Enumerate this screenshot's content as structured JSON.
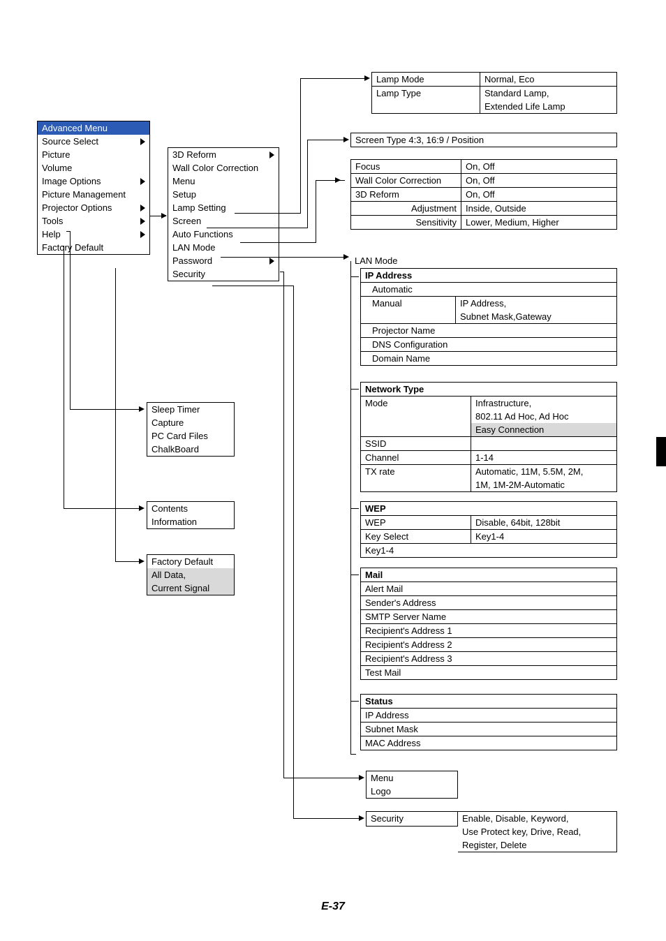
{
  "page_footer": "E-37",
  "main_menu": {
    "title": "Advanced Menu",
    "items": [
      "Source Select",
      "Picture",
      "Volume",
      "Image Options",
      "Picture Management",
      "Projector Options",
      "Tools",
      "Help",
      "Factory Default"
    ]
  },
  "projector_options_sub": [
    "3D Reform",
    "Wall Color Correction",
    "Menu",
    "Setup",
    "Lamp Setting",
    "Screen",
    "Auto Functions",
    "LAN Mode",
    "Password",
    "Security"
  ],
  "tools_sub": [
    "Sleep Timer",
    "Capture",
    "PC Card Files",
    "ChalkBoard"
  ],
  "help_sub": [
    "Contents",
    "Information"
  ],
  "factory_default_sub": [
    "Factory Default",
    "All Data,",
    "Current Signal"
  ],
  "lamp_setting": {
    "rows": [
      {
        "label": "Lamp Mode",
        "value": "Normal, Eco"
      },
      {
        "label": "Lamp Type",
        "value": "Standard Lamp,"
      }
    ],
    "extra_value": "Extended Life Lamp"
  },
  "screen_setting": {
    "text": "Screen Type 4:3, 16:9 / Position"
  },
  "auto_functions": {
    "rows": [
      {
        "label": "Focus",
        "value": "On, Off"
      },
      {
        "label": "Wall Color Correction",
        "value": "On, Off"
      },
      {
        "label": "3D Reform",
        "value": "On, Off"
      },
      {
        "label": "Adjustment",
        "value": "Inside, Outside",
        "align": "right"
      },
      {
        "label": "Sensitivity",
        "value": "Lower, Medium, Higher",
        "align": "right"
      }
    ]
  },
  "lan_mode": {
    "title": "LAN Mode",
    "ip_address": {
      "header": "IP Address",
      "rows": [
        {
          "label": "Automatic",
          "value": ""
        },
        {
          "label": "Manual",
          "value": "IP Address,"
        },
        {
          "label": "",
          "value": "Subnet Mask,Gateway"
        },
        {
          "label": "Projector Name",
          "value": ""
        },
        {
          "label": "DNS Configuration",
          "value": ""
        },
        {
          "label": "Domain Name",
          "value": ""
        }
      ]
    },
    "network_type": {
      "header": "Network Type",
      "rows": [
        {
          "label": "Mode",
          "value": "Infrastructure,"
        },
        {
          "label": "",
          "value": "802.11 Ad Hoc, Ad Hoc"
        },
        {
          "label": "",
          "value": "Easy Connection"
        },
        {
          "label": "SSID",
          "value": ""
        },
        {
          "label": "Channel",
          "value": "1-14"
        },
        {
          "label": "TX rate",
          "value": "Automatic, 11M, 5.5M, 2M,"
        },
        {
          "label": "",
          "value": "1M, 1M-2M-Automatic"
        }
      ]
    },
    "wep": {
      "header": "WEP",
      "rows": [
        {
          "label": "WEP",
          "value": "Disable, 64bit, 128bit"
        },
        {
          "label": "Key Select",
          "value": "Key1-4"
        },
        {
          "label": "Key1-4",
          "value": ""
        }
      ]
    },
    "mail": {
      "header": "Mail",
      "rows": [
        "Alert Mail",
        "Sender's Address",
        "SMTP Server Name",
        "Recipient's Address 1",
        "Recipient's Address 2",
        "Recipient's Address 3",
        "Test Mail"
      ]
    },
    "status": {
      "header": "Status",
      "rows": [
        "IP Address",
        "Subnet Mask",
        "MAC Address"
      ]
    }
  },
  "password_sub": {
    "rows": [
      "Menu",
      "Logo"
    ]
  },
  "security_sub": {
    "label": "Security",
    "lines": [
      "Enable, Disable, Keyword,",
      "Use Protect key, Drive, Read,",
      "Register, Delete"
    ]
  }
}
